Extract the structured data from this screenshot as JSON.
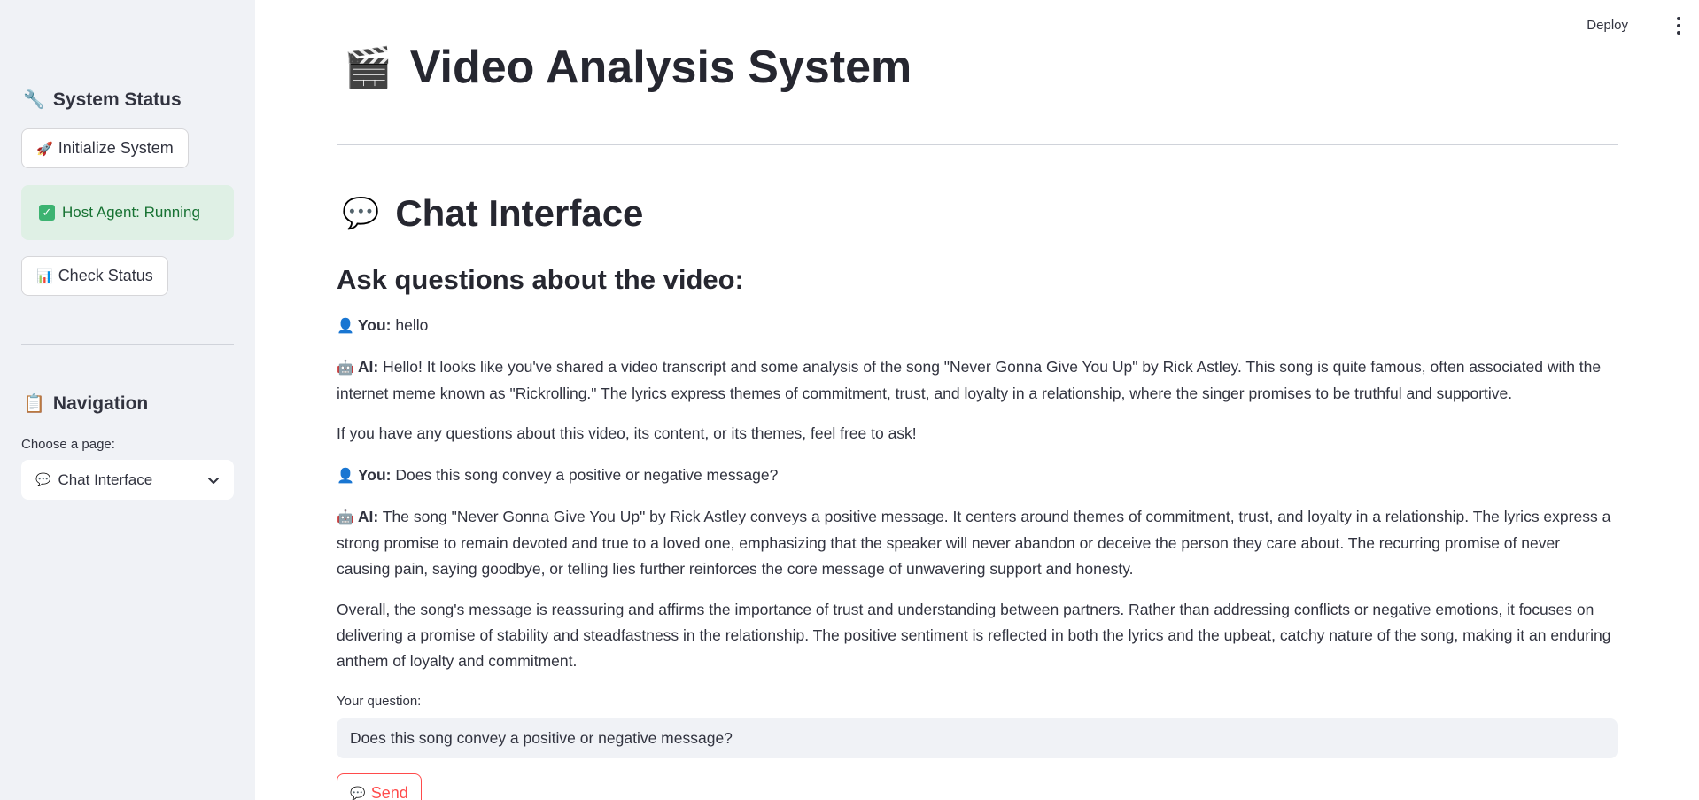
{
  "header": {
    "deploy_label": "Deploy",
    "menu_icon": "kebab-menu-icon"
  },
  "sidebar": {
    "system_status": {
      "icon": "🔧",
      "title": "System Status"
    },
    "initialize_button": {
      "icon": "🚀",
      "label": "Initialize System"
    },
    "status_message": {
      "icon": "✓",
      "text": "Host Agent: Running",
      "color": "#177233",
      "background": "#dff0e5"
    },
    "check_status_button": {
      "icon": "📊",
      "label": "Check Status"
    },
    "navigation": {
      "icon": "📋",
      "title": "Navigation",
      "select_label": "Choose a page:",
      "selected": {
        "icon": "💬",
        "label": "Chat Interface"
      }
    }
  },
  "main": {
    "title": {
      "icon": "🎬",
      "text": "Video Analysis System"
    },
    "section": {
      "icon": "💬",
      "text": "Chat Interface"
    },
    "subheading": "Ask questions about the video:",
    "messages": [
      {
        "icon": "👤",
        "speaker": "You:",
        "text": "hello"
      },
      {
        "icon": "🤖",
        "speaker": "AI:",
        "text": "Hello! It looks like you've shared a video transcript and some analysis of the song \"Never Gonna Give You Up\" by Rick Astley. This song is quite famous, often associated with the internet meme known as \"Rickrolling.\" The lyrics express themes of commitment, trust, and loyalty in a relationship, where the singer promises to be truthful and supportive."
      },
      {
        "text": "If you have any questions about this video, its content, or its themes, feel free to ask!"
      },
      {
        "icon": "👤",
        "speaker": "You:",
        "text": "Does this song convey a positive or negative message?"
      },
      {
        "icon": "🤖",
        "speaker": "AI:",
        "text": "The song \"Never Gonna Give You Up\" by Rick Astley conveys a positive message. It centers around themes of commitment, trust, and loyalty in a relationship. The lyrics express a strong promise to remain devoted and true to a loved one, emphasizing that the speaker will never abandon or deceive the person they care about. The recurring promise of never causing pain, saying goodbye, or telling lies further reinforces the core message of unwavering support and honesty."
      },
      {
        "text": "Overall, the song's message is reassuring and affirms the importance of trust and understanding between partners. Rather than addressing conflicts or negative emotions, it focuses on delivering a promise of stability and steadfastness in the relationship. The positive sentiment is reflected in both the lyrics and the upbeat, catchy nature of the song, making it an enduring anthem of loyalty and commitment."
      }
    ],
    "question_label": "Your question:",
    "question_value": "Does this song convey a positive or negative message?",
    "send_button": {
      "icon": "💬",
      "label": "Send",
      "color": "#ff4b4b"
    }
  }
}
